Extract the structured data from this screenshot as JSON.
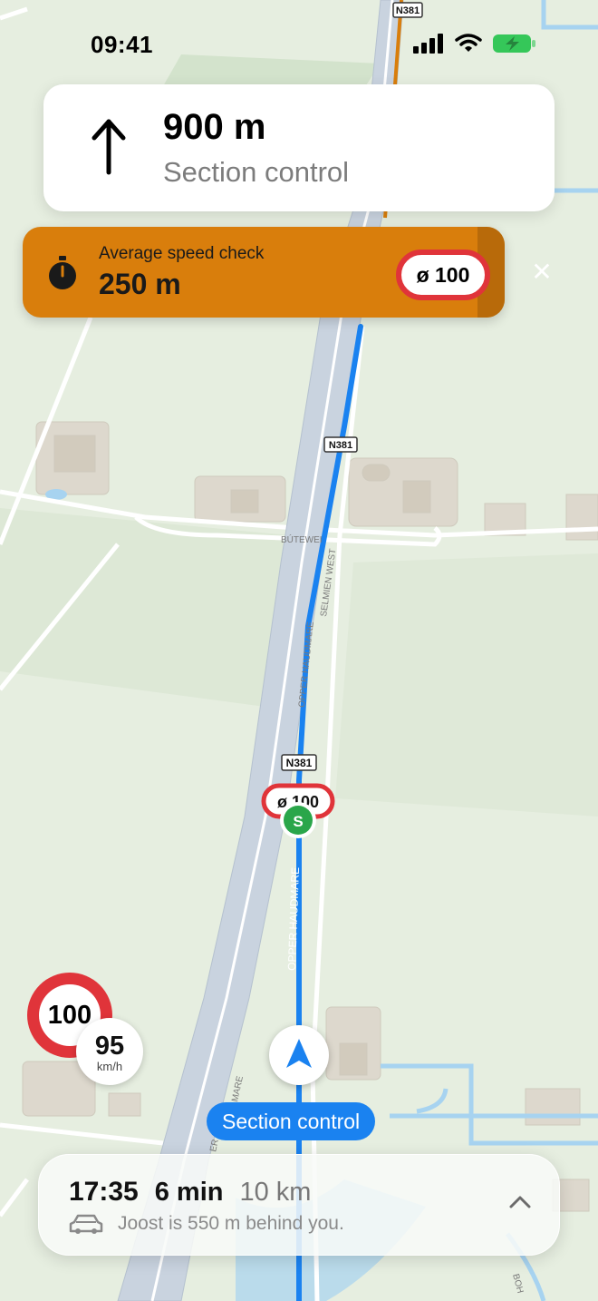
{
  "status_bar": {
    "time": "09:41"
  },
  "map": {
    "road_shields": [
      "N381",
      "N381",
      "N381"
    ],
    "street_labels": [
      "BÚTEWEI",
      "SELMIEN WEST",
      "OPPER HAUDMARE",
      "OPPER HAUDMARE",
      "MARE",
      "BOH",
      "ER"
    ],
    "route_color": "#1a82f0",
    "inline_speed_sign": "ø 100",
    "section_start_marker": "S"
  },
  "navigation": {
    "distance": "900 m",
    "instruction": "Section control",
    "arrow_icon": "arrow-up-icon"
  },
  "speed_check_banner": {
    "title": "Average speed check",
    "distance": "250 m",
    "limit": "ø 100",
    "icon": "stopwatch-icon",
    "close_label": "✕",
    "color": "#d97e0c"
  },
  "speed": {
    "limit": "100",
    "current": "95",
    "unit": "km/h"
  },
  "section_pill": "Section control",
  "trip": {
    "eta": "17:35",
    "duration": "6 min",
    "distance": "10 km",
    "note": "Joost is 550 m behind you."
  }
}
